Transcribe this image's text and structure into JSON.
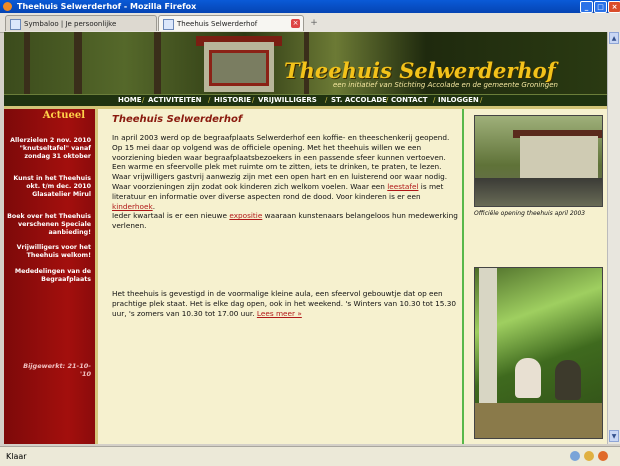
{
  "window": {
    "title": "Theehuis Selwerderhof - Mozilla Firefox",
    "min": "_",
    "max": "□",
    "close": "×"
  },
  "tabs": [
    {
      "label": "Symbaloo | Je persoonlijke Startpagina",
      "active": false
    },
    {
      "label": "Theehuis Selwerderhof",
      "active": true
    }
  ],
  "newtab": "+",
  "site": {
    "title": "Theehuis Selwerderhof",
    "subtitle": "een initiatief van Stichting Accolade en de gemeente Groningen"
  },
  "nav": [
    "HOME",
    "ACTIVITEITEN",
    "HISTORIE",
    "VRIJWILLIGERS",
    "ST. ACCOLADE",
    "CONTACT",
    "INLOGGEN"
  ],
  "nav_sep": "/",
  "sidebar": {
    "heading": "Actueel",
    "links": [
      "Allerzielen 2 nov. 2010 \"knutseltafel\" vanaf zondag 31 oktober",
      "Kunst in het Theehuis okt. t/m dec. 2010 Glasatelier Mirul",
      "Boek over het Theehuis verschenen Speciale aanbieding!",
      "Vrijwilligers voor het Theehuis welkom!",
      "Mededelingen van de Begraafplaats"
    ],
    "updated": "Bijgewerkt: 21-10-'10"
  },
  "content": {
    "title": "Theehuis Selwerderhof",
    "p1_a": "In april 2003 werd op de begraafplaats Selwerderhof een koffie- en theeschenkerij geopend. Op 15 mei daar op volgend was de officiele opening. Met het theehuis willen we een voorziening bieden waar begraafplaatsbezoekers in een passende sfeer kunnen vertoeven. Een warme en sfeervolle plek met ruimte om te zitten, iets te drinken, te praten, te lezen. Waar vrijwilligers gastvrij aanwezig zijn met een open hart en en luisterend oor waar nodig. Waar voorzieningen zijn zodat ook kinderen zich welkom voelen. Waar een ",
    "link_leestafel": "leestafel",
    "p1_b": " is met literatuur en informatie over diverse aspecten rond de dood. Voor kinderen is er een ",
    "link_kinderhoek": "kinderhoek",
    "p1_c": ".",
    "p1_d": "Ieder kwartaal is er een nieuwe ",
    "link_expositie": "expositie",
    "p1_e": " waaraan kunstenaars belangeloos hun medewerking verlenen.",
    "p2": "Het theehuis is gevestigd in de voormalige kleine aula, een sfeervol gebouwtje dat op een prachtige plek staat. Het is elke dag open, ook in het weekend. 's Winters van 10.30 tot 15.30 uur, 's zomers van 10.30 tot 17.00 uur. ",
    "link_lees_meer": "Lees meer »"
  },
  "right": {
    "caption": "Officiële opening theehuis april 2003"
  },
  "status": {
    "text": "Klaar"
  }
}
